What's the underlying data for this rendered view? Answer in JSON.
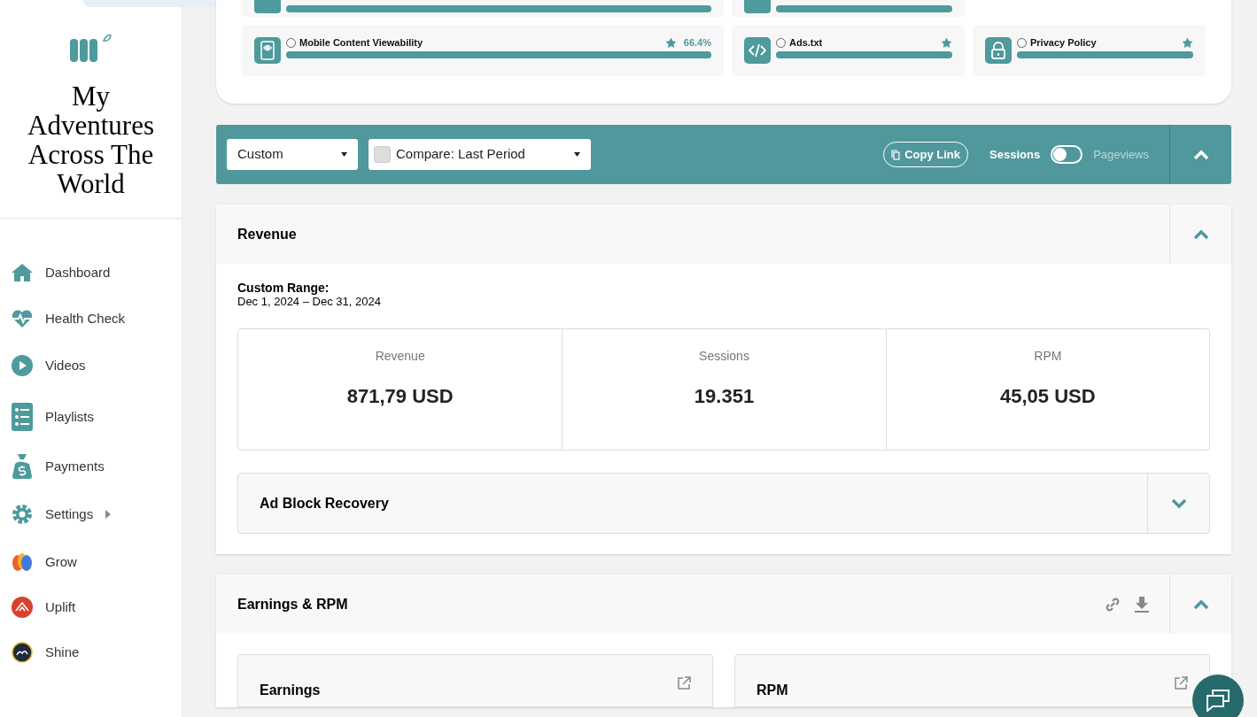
{
  "site": {
    "title": "My Adventures Across The World"
  },
  "sidebar": {
    "items": [
      {
        "label": "Dashboard"
      },
      {
        "label": "Health Check"
      },
      {
        "label": "Videos"
      },
      {
        "label": "Playlists"
      },
      {
        "label": "Payments"
      },
      {
        "label": "Settings"
      },
      {
        "label": "Grow"
      },
      {
        "label": "Uplift"
      },
      {
        "label": "Shine"
      }
    ]
  },
  "health": {
    "partial_items": [
      {
        "level": 1
      },
      {
        "level": 1
      }
    ],
    "items": [
      {
        "label": "Mobile Content Viewability",
        "starred": true,
        "value": "66.4%",
        "level": 1
      },
      {
        "label": "Ads.txt",
        "starred": true,
        "level": 1
      },
      {
        "label": "Privacy Policy",
        "starred": true,
        "level": 1
      }
    ]
  },
  "filter_bar": {
    "range": "Custom",
    "compare": "Compare: Last Period",
    "compare_checked": false,
    "copy_link": "Copy Link",
    "toggle": {
      "left_label": "Sessions",
      "right_label": "Pageviews",
      "on": false
    },
    "expanded": true
  },
  "revenue": {
    "title": "Revenue",
    "expanded": true,
    "range_label": "Custom Range:",
    "range": "Dec 1, 2024 – Dec 31, 2024",
    "stats": [
      {
        "label": "Revenue",
        "value": "871,79 USD"
      },
      {
        "label": "Sessions",
        "value": "19.351"
      },
      {
        "label": "RPM",
        "value": "45,05 USD"
      }
    ],
    "subsection": {
      "title": "Ad Block Recovery",
      "expanded": false
    }
  },
  "earnings": {
    "title": "Earnings & RPM",
    "expanded": true,
    "cards": [
      {
        "title": "Earnings"
      },
      {
        "title": "RPM"
      }
    ]
  }
}
